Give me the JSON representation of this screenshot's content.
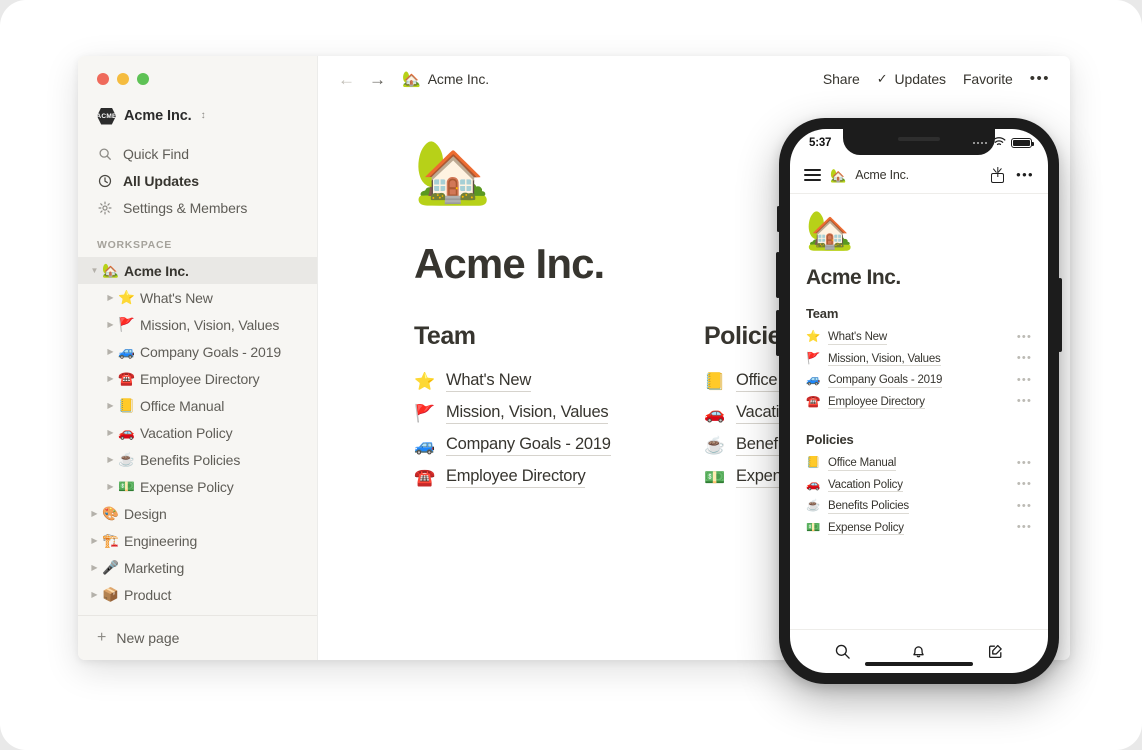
{
  "window": {
    "traffic_lights": [
      "close",
      "minimize",
      "zoom"
    ],
    "colors": {
      "close": "#ef6a5b",
      "minimize": "#f5bc3f",
      "zoom": "#5ec255"
    }
  },
  "sidebar": {
    "workspace_badge": "ACME",
    "workspace_name": "Acme Inc.",
    "nav": [
      {
        "icon": "search-icon",
        "label": "Quick Find",
        "strong": false
      },
      {
        "icon": "clock-icon",
        "label": "All Updates",
        "strong": true
      },
      {
        "icon": "gear-icon",
        "label": "Settings & Members",
        "strong": false
      }
    ],
    "section_label": "WORKSPACE",
    "tree": [
      {
        "level": 0,
        "emoji": "🏡",
        "label": "Acme Inc.",
        "selected": true,
        "expanded": true
      },
      {
        "level": 1,
        "emoji": "⭐",
        "label": "What's New",
        "selected": false,
        "expanded": false
      },
      {
        "level": 1,
        "emoji": "🚩",
        "label": "Mission, Vision, Values",
        "selected": false,
        "expanded": false
      },
      {
        "level": 1,
        "emoji": "🚙",
        "label": "Company Goals - 2019",
        "selected": false,
        "expanded": false
      },
      {
        "level": 1,
        "emoji": "☎️",
        "label": "Employee Directory",
        "selected": false,
        "expanded": false
      },
      {
        "level": 1,
        "emoji": "📒",
        "label": "Office Manual",
        "selected": false,
        "expanded": false
      },
      {
        "level": 1,
        "emoji": "🚗",
        "label": "Vacation Policy",
        "selected": false,
        "expanded": false
      },
      {
        "level": 1,
        "emoji": "☕",
        "label": "Benefits Policies",
        "selected": false,
        "expanded": false
      },
      {
        "level": 1,
        "emoji": "💵",
        "label": "Expense Policy",
        "selected": false,
        "expanded": false
      },
      {
        "level": 0,
        "emoji": "🎨",
        "label": "Design",
        "selected": false,
        "expanded": false
      },
      {
        "level": 0,
        "emoji": "🏗️",
        "label": "Engineering",
        "selected": false,
        "expanded": false
      },
      {
        "level": 0,
        "emoji": "🎤",
        "label": "Marketing",
        "selected": false,
        "expanded": false
      },
      {
        "level": 0,
        "emoji": "📦",
        "label": "Product",
        "selected": false,
        "expanded": false
      }
    ],
    "footer": {
      "icon": "plus-icon",
      "label": "New page"
    }
  },
  "topbar": {
    "back_icon": "arrow-left-icon",
    "forward_icon": "arrow-right-icon",
    "breadcrumb_emoji": "🏡",
    "breadcrumb_label": "Acme Inc.",
    "share_label": "Share",
    "updates_label": "Updates",
    "updates_check": "✓",
    "favorite_label": "Favorite",
    "more_label": "•••"
  },
  "page": {
    "emoji": "🏡",
    "title": "Acme Inc.",
    "columns": [
      {
        "title": "Team",
        "links": [
          {
            "emoji": "⭐",
            "label": "What's New"
          },
          {
            "emoji": "🚩",
            "label": "Mission, Vision, Values"
          },
          {
            "emoji": "🚙",
            "label": "Company Goals - 2019"
          },
          {
            "emoji": "☎️",
            "label": "Employee Directory"
          }
        ]
      },
      {
        "title": "Policies",
        "links": [
          {
            "emoji": "📒",
            "label": "Office Manual"
          },
          {
            "emoji": "🚗",
            "label": "Vacation Policy"
          },
          {
            "emoji": "☕",
            "label": "Benefits Policies"
          },
          {
            "emoji": "💵",
            "label": "Expense Policy"
          }
        ]
      }
    ]
  },
  "phone": {
    "status": {
      "time": "5:37",
      "cellular": "signal-dots",
      "wifi": "wifi-icon",
      "battery": "battery-icon"
    },
    "topbar": {
      "menu_icon": "hamburger-menu-icon",
      "emoji": "🏡",
      "title": "Acme Inc.",
      "share_icon": "share-icon",
      "more_label": "•••"
    },
    "page": {
      "emoji": "🏡",
      "title": "Acme Inc.",
      "sections": [
        {
          "title": "Team",
          "rows": [
            {
              "emoji": "⭐",
              "label": "What's New",
              "more": "•••"
            },
            {
              "emoji": "🚩",
              "label": "Mission, Vision, Values",
              "more": "•••"
            },
            {
              "emoji": "🚙",
              "label": "Company Goals - 2019",
              "more": "•••"
            },
            {
              "emoji": "☎️",
              "label": "Employee Directory",
              "more": "•••"
            }
          ]
        },
        {
          "title": "Policies",
          "rows": [
            {
              "emoji": "📒",
              "label": "Office Manual",
              "more": "•••"
            },
            {
              "emoji": "🚗",
              "label": "Vacation Policy",
              "more": "•••"
            },
            {
              "emoji": "☕",
              "label": "Benefits Policies",
              "more": "•••"
            },
            {
              "emoji": "💵",
              "label": "Expense Policy",
              "more": "•••"
            }
          ]
        }
      ]
    },
    "tabbar": [
      {
        "icon": "search-icon"
      },
      {
        "icon": "bell-icon"
      },
      {
        "icon": "compose-icon"
      }
    ]
  }
}
